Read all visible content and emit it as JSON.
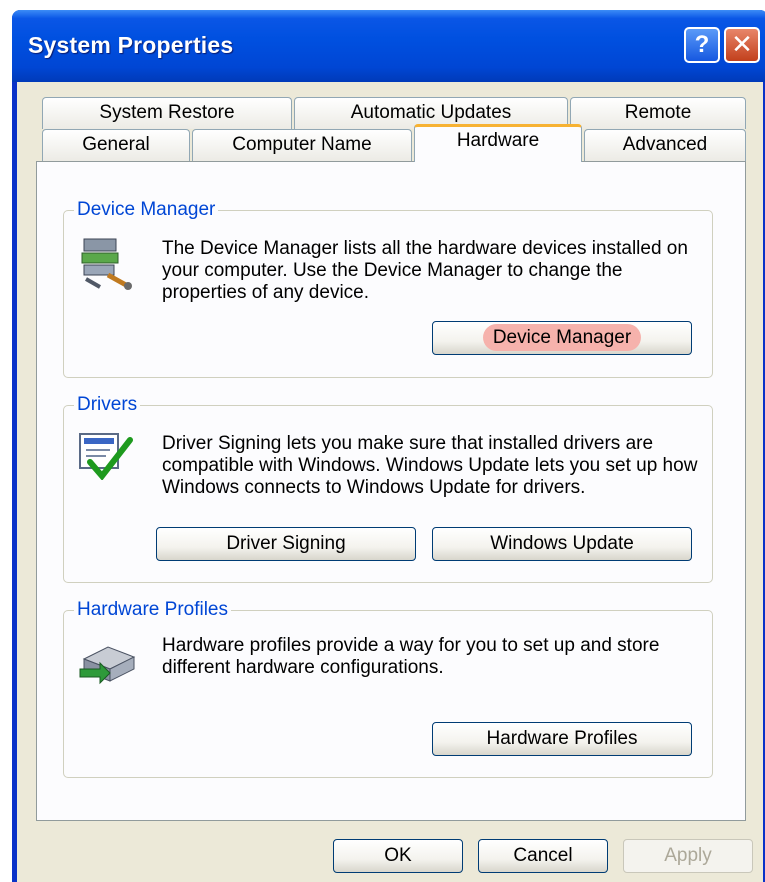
{
  "window": {
    "title": "System Properties"
  },
  "titlebar_icons": [
    "help-icon",
    "close-icon"
  ],
  "glyphs": {
    "help": "?",
    "close": "✕"
  },
  "tabs": {
    "row1": [
      "System Restore",
      "Automatic Updates",
      "Remote"
    ],
    "row2": [
      "General",
      "Computer Name",
      "Hardware",
      "Advanced"
    ],
    "selected": "Hardware"
  },
  "groups": {
    "device_manager": {
      "label": "Device Manager",
      "description": "The Device Manager lists all the hardware devices installed on your computer. Use the Device Manager to change the properties of any device.",
      "button": "Device Manager",
      "icon": "device-manager-icon"
    },
    "drivers": {
      "label": "Drivers",
      "description": "Driver Signing lets you make sure that installed drivers are compatible with Windows. Windows Update lets you set up how Windows connects to Windows Update for drivers.",
      "buttons": [
        "Driver Signing",
        "Windows Update"
      ],
      "icon": "driver-signing-icon"
    },
    "hardware_profiles": {
      "label": "Hardware Profiles",
      "description": "Hardware profiles provide a way for you to set up and store different hardware configurations.",
      "button": "Hardware Profiles",
      "icon": "hardware-profiles-icon"
    }
  },
  "footer": {
    "ok": "OK",
    "cancel": "Cancel",
    "apply": "Apply"
  },
  "colors": {
    "titlebar": "#0050e0",
    "group_label": "#0046d5",
    "tab_highlight": "#f7b232",
    "button_highlight": "#f6b2ac"
  }
}
